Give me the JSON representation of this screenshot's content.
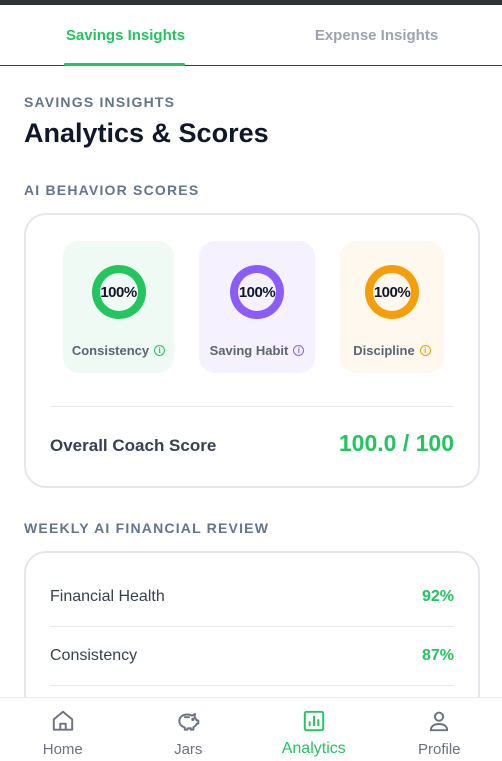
{
  "tabs": [
    {
      "label": "Savings Insights",
      "active": true
    },
    {
      "label": "Expense Insights",
      "active": false
    }
  ],
  "header": {
    "eyebrow": "SAVINGS INSIGHTS",
    "title": "Analytics & Scores"
  },
  "scores_section": {
    "label": "AI BEHAVIOR SCORES",
    "items": [
      {
        "label": "Consistency",
        "value": "100%",
        "percent": 100,
        "color": "#22c55e",
        "bg": "#effaf4"
      },
      {
        "label": "Saving Habit",
        "value": "100%",
        "percent": 100,
        "color": "#8b5cf6",
        "bg": "#f5f1ff"
      },
      {
        "label": "Discipline",
        "value": "100%",
        "percent": 100,
        "color": "#f59e0b",
        "bg": "#fff8ef"
      }
    ],
    "overall_label": "Overall Coach Score",
    "overall_value": "100.0 / 100"
  },
  "review_section": {
    "label": "WEEKLY AI FINANCIAL REVIEW",
    "rows": [
      {
        "label": "Financial Health",
        "value": "92%"
      },
      {
        "label": "Consistency",
        "value": "87%"
      }
    ]
  },
  "nav": [
    {
      "label": "Home",
      "icon": "home-icon",
      "active": false
    },
    {
      "label": "Jars",
      "icon": "piggy-bank-icon",
      "active": false
    },
    {
      "label": "Analytics",
      "icon": "analytics-icon",
      "active": true
    },
    {
      "label": "Profile",
      "icon": "profile-icon",
      "active": false
    }
  ],
  "colors": {
    "accent": "#22c55e",
    "purple": "#8b5cf6",
    "orange": "#f59e0b"
  }
}
